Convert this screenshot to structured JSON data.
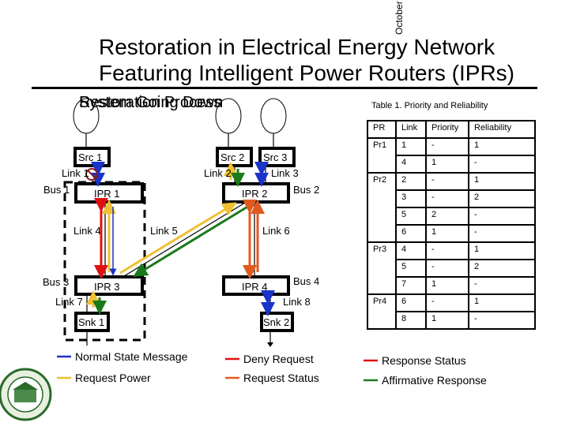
{
  "header": {
    "date_fragment": "October",
    "title_line1": "Restoration in Electrical Energy Network",
    "title_line2": "Featuring Intelligent Power Routers (IPRs)",
    "state_headings": [
      "Restoration Process",
      "System Going Down"
    ]
  },
  "diagram": {
    "sources": [
      "Src 1",
      "Src 2",
      "Src 3"
    ],
    "iprs": [
      "IPR 1",
      "IPR 2",
      "IPR 3",
      "IPR 4"
    ],
    "sinks": [
      "Snk 1",
      "Snk 2"
    ],
    "buses": [
      "Bus 1",
      "Bus 2",
      "Bus 3",
      "Bus 4"
    ],
    "links": [
      "Link 1",
      "Link 2",
      "Link 3",
      "Link 4",
      "Link 5",
      "Link 6",
      "Link 7",
      "Link 8"
    ],
    "fault_icon": "prohibited-icon"
  },
  "legend": [
    {
      "label": "Normal State Message",
      "color": "#1a33c8"
    },
    {
      "label": "Request Power",
      "color": "#f0c030"
    },
    {
      "label": "Deny Request",
      "color": "#e01010"
    },
    {
      "label": "Request Status",
      "color": "#e05a20"
    },
    {
      "label": "Response Status",
      "color": "#e01010"
    },
    {
      "label": "Affirmative Response",
      "color": "#1a7a1a"
    }
  ],
  "table": {
    "caption": "Table 1. Priority and Reliability",
    "headers": [
      "PR",
      "Link",
      "Priority",
      "Reliability"
    ],
    "groups": [
      {
        "pr": "Pr1",
        "rows": [
          [
            "1",
            "-",
            "1"
          ],
          [
            "4",
            "1",
            "-"
          ]
        ]
      },
      {
        "pr": "Pr2",
        "rows": [
          [
            "2",
            "-",
            "1"
          ],
          [
            "3",
            "-",
            "2"
          ],
          [
            "5",
            "2",
            "-"
          ],
          [
            "6",
            "1",
            "-"
          ]
        ]
      },
      {
        "pr": "Pr3",
        "rows": [
          [
            "4",
            "-",
            "1"
          ],
          [
            "5",
            "-",
            "2"
          ],
          [
            "7",
            "1",
            "-"
          ]
        ]
      },
      {
        "pr": "Pr4",
        "rows": [
          [
            "6",
            "-",
            "1"
          ],
          [
            "8",
            "1",
            "-"
          ]
        ]
      }
    ]
  }
}
